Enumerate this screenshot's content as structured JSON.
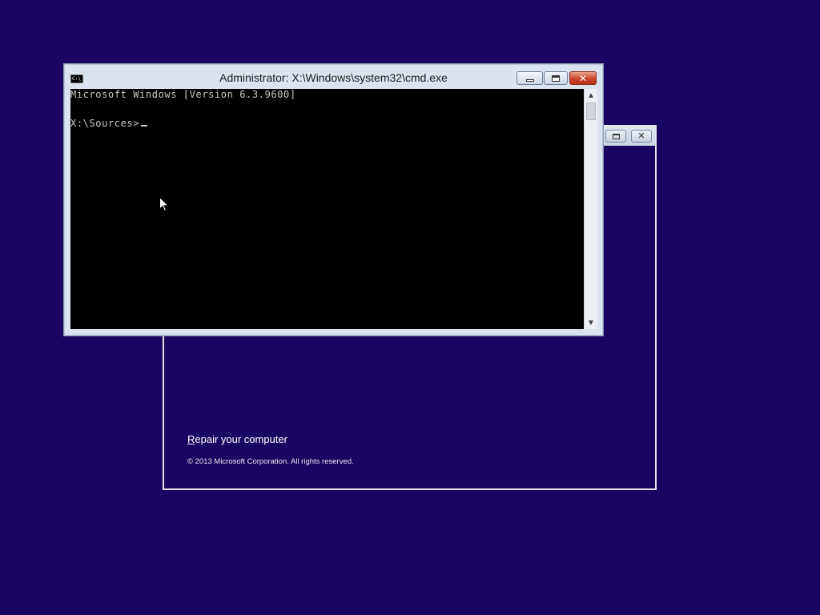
{
  "background_color": "#1a0563",
  "setup_window": {
    "restore_icon": "restore-icon",
    "close_icon": "close-icon",
    "repair_link": {
      "first_letter": "R",
      "rest": "epair your computer"
    },
    "copyright": "© 2013 Microsoft Corporation. All rights reserved."
  },
  "cmd_window": {
    "icon_label": "C:\\",
    "title": "Administrator: X:\\Windows\\system32\\cmd.exe",
    "buttons": {
      "minimize": "minimize-icon",
      "maximize": "maximize-icon",
      "close": "✕"
    },
    "console_lines": {
      "version": "Microsoft Windows [Version 6.3.9600]",
      "prompt": "X:\\Sources>"
    },
    "scrollbar": {
      "up": "▲",
      "down": "▼"
    }
  }
}
